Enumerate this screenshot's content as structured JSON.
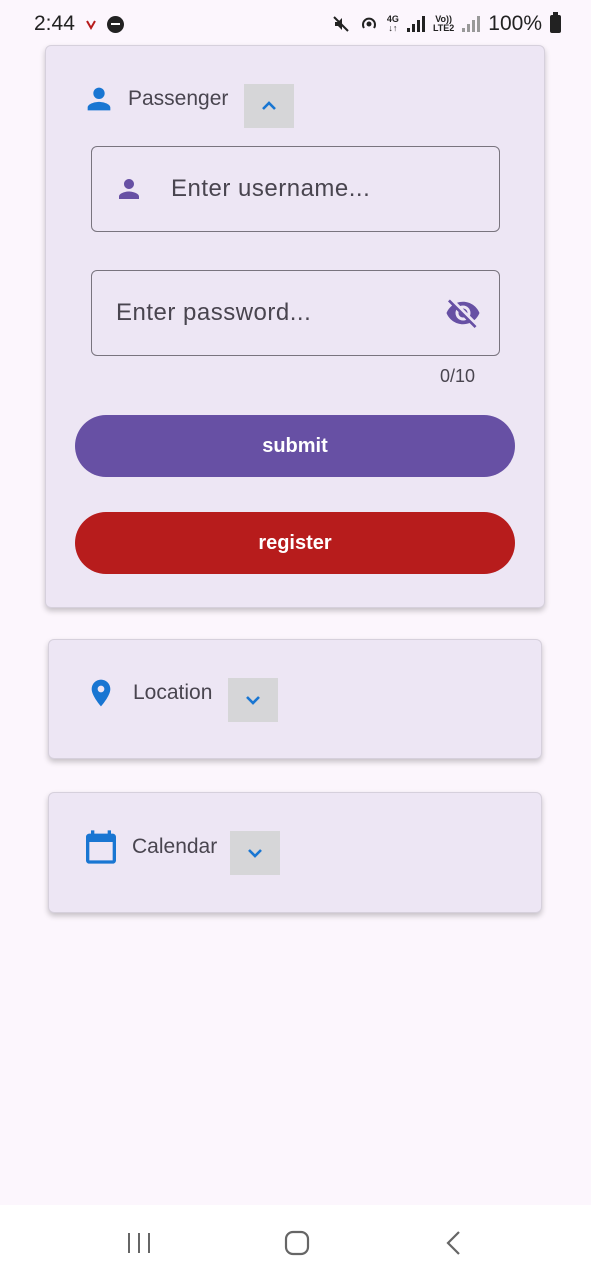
{
  "status_bar": {
    "time": "2:44",
    "battery": "100%",
    "net_4g": "4G",
    "volte": "Vo))",
    "lte2": "LTE2"
  },
  "passenger_panel": {
    "title": "Passenger",
    "expanded": true,
    "username": {
      "placeholder": "Enter username...",
      "value": ""
    },
    "password": {
      "placeholder": "Enter password...",
      "value": ""
    },
    "counter": "0/10",
    "submit_label": "submit",
    "register_label": "register"
  },
  "location_panel": {
    "title": "Location",
    "expanded": false
  },
  "calendar_panel": {
    "title": "Calendar",
    "expanded": false
  },
  "colors": {
    "primary": "#6750a4",
    "icon_blue": "#1976d2",
    "register_red": "#b71c1c",
    "card_bg": "#ede6f4",
    "page_bg": "#fcf6fd"
  },
  "icons": {
    "passenger": "person-icon",
    "location": "location-pin-icon",
    "calendar": "calendar-icon",
    "expand": "chevron-up-icon",
    "collapse": "chevron-down-icon",
    "visibility": "visibility-off-icon"
  }
}
